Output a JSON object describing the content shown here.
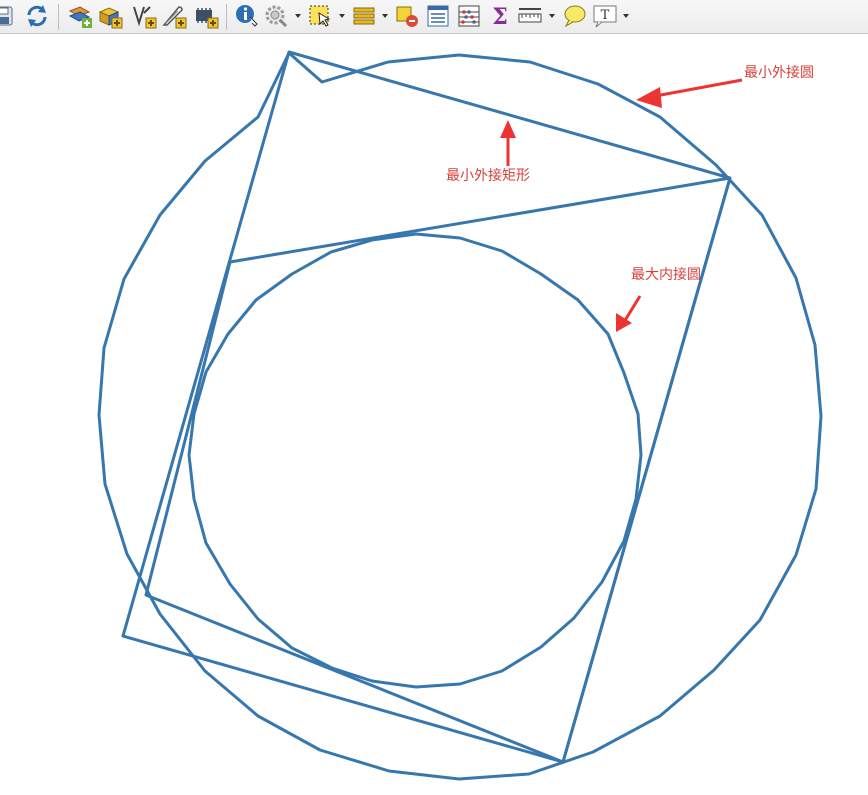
{
  "toolbar": {
    "buttons": [
      {
        "name": "save-project-button",
        "icon": "save-icon"
      },
      {
        "name": "refresh-button",
        "icon": "refresh-icon"
      },
      {
        "name": "new-geopackage-layer-button",
        "icon": "new-layer-icon"
      },
      {
        "name": "new-shapefile-layer-button",
        "icon": "new-shapefile-icon"
      },
      {
        "name": "vertex-tool-button",
        "icon": "vertex-tool-icon"
      },
      {
        "name": "digitize-button",
        "icon": "pen-icon"
      },
      {
        "name": "new-memory-layer-button",
        "icon": "memory-layer-icon"
      },
      {
        "name": "identify-features-button",
        "icon": "info-icon"
      },
      {
        "name": "zoom-tool-button",
        "icon": "zoom-gear-icon"
      },
      {
        "name": "select-features-button",
        "icon": "select-icon"
      },
      {
        "name": "attribute-table-button",
        "icon": "table-layers-icon"
      },
      {
        "name": "deselect-all-button",
        "icon": "deselect-icon"
      },
      {
        "name": "open-attribute-table-button",
        "icon": "attribute-table-icon"
      },
      {
        "name": "field-calculator-button",
        "icon": "abacus-icon"
      },
      {
        "name": "statistics-button",
        "icon": "sigma-icon"
      },
      {
        "name": "measure-button",
        "icon": "ruler-icon"
      },
      {
        "name": "map-tips-button",
        "icon": "speech-bubble-icon"
      },
      {
        "name": "text-annotation-button",
        "icon": "text-annotation-icon"
      }
    ],
    "text_icon_glyph": "T",
    "sigma_glyph": "Σ"
  },
  "labels": {
    "min_enclosing_circle": "最小外接圆",
    "min_bounding_rectangle": "最小外接矩形",
    "max_inscribed_circle": "最大内接圆"
  },
  "colors": {
    "geometry_stroke": "#3777ad",
    "annotation_text": "#d8413a",
    "annotation_arrow": "#ee3333"
  }
}
